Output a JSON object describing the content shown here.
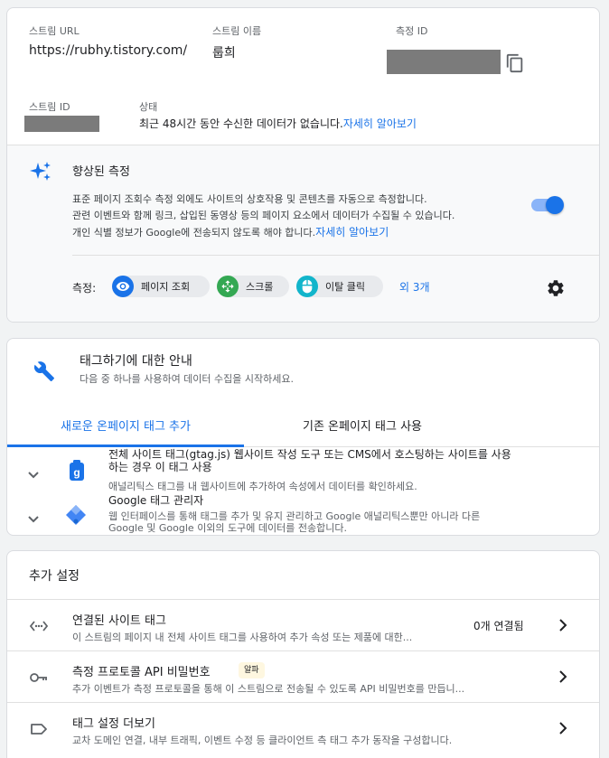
{
  "stream": {
    "url_label": "스트림 URL",
    "url_value": "https://rubhy.tistory.com/",
    "name_label": "스트림 이름",
    "name_value": "룹희",
    "measurement_id_label": "측정 ID",
    "stream_id_label": "스트림 ID",
    "status_label": "상태",
    "status_text": "최근 48시간 동안 수신한 데이터가 없습니다.",
    "status_link": "자세히 알아보기"
  },
  "enhanced": {
    "title": "향상된 측정",
    "desc_line1": "표준 페이지 조회수 측정 외에도 사이트의 상호작용 및 콘텐츠를 자동으로 측정합니다.",
    "desc_line2": "관련 이벤트와 함께 링크, 삽입된 동영상 등의 페이지 요소에서 데이터가 수집될 수 있습니다.",
    "desc_line3": "개인 식별 정보가 Google에 전송되지 않도록 해야 합니다.",
    "desc_link": "자세히 알아보기",
    "toggle_on": true,
    "measure_label": "측정:",
    "chips": [
      "페이지 조회",
      "스크롤",
      "이탈 클릭"
    ],
    "more_link": "외 3개"
  },
  "tagging": {
    "title": "태그하기에 대한 안내",
    "subtitle": "다음 중 하나를 사용하여 데이터 수집을 시작하세요.",
    "tabs": [
      "새로운 온페이지 태그 추가",
      "기존 온페이지 태그 사용"
    ],
    "items": [
      {
        "title_line1": "전체 사이트 태그(gtag.js) 웹사이트 작성 도구 또는 CMS에서 호스팅하는 사이트를 사용",
        "title_line2": "하는 경우 이 태그 사용",
        "desc_line1": "애널리틱스 태그를 내 웹사이트에 추가하여 속성에서 데이터를 확인하세요."
      },
      {
        "title_line1": "Google 태그 관리자",
        "desc_line1": "웹 인터페이스를 통해 태그를 추가 및 유지 관리하고 Google 애널리틱스뿐만 아니라 다른",
        "desc_line2": "Google 및 Google 이외의 도구에 데이터를 전송합니다."
      }
    ]
  },
  "additional": {
    "title": "추가 설정",
    "rows": [
      {
        "title": "연결된 사이트 태그",
        "desc": "이 스트림의 페이지 내 전체 사이트 태그를 사용하여 추가 속성 또는 제품에 대한...",
        "status": "0개 연결됨"
      },
      {
        "title": "측정 프로토콜 API 비밀번호",
        "badge": "알파",
        "desc": "추가 이벤트가 측정 프로토콜을 통해 이 스트림으로 전송될 수 있도록 API 비밀번호를 만듭니..."
      },
      {
        "title": "태그 설정 더보기",
        "desc": "교차 도메인 연결, 내부 트래픽, 이벤트 수정 등 클라이언트 측 태그 추가 동작을 구성합니다."
      }
    ]
  },
  "colors": {
    "accent": "#1a73e8",
    "toggle": "#1a73e8",
    "redaction": "#7b7b7b",
    "badge_bg": "#fef7e0"
  },
  "icons": {
    "copy": "copy-icon",
    "sparkle": "sparkle-icon",
    "settings": "gear-icon",
    "wrench": "wrench-icon",
    "chevron_down": "chevron-down-icon",
    "gtag": "gtag-icon",
    "gtm": "gtm-icon",
    "code": "code-icon",
    "key": "key-icon",
    "label": "label-icon",
    "chevron_right": "chevron-right-icon"
  }
}
